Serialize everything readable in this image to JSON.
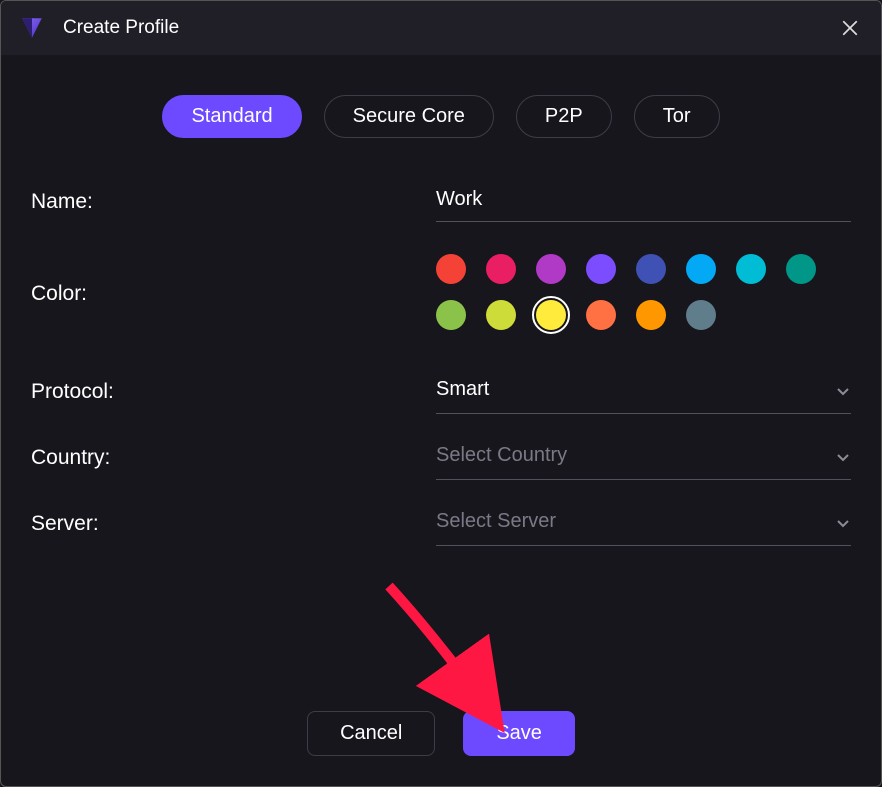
{
  "header": {
    "title": "Create Profile"
  },
  "tabs": {
    "standard": "Standard",
    "secure_core": "Secure Core",
    "p2p": "P2P",
    "tor": "Tor",
    "active": "standard"
  },
  "labels": {
    "name": "Name:",
    "color": "Color:",
    "protocol": "Protocol:",
    "country": "Country:",
    "server": "Server:"
  },
  "fields": {
    "name_value": "Work",
    "protocol_value": "Smart",
    "country_placeholder": "Select Country",
    "server_placeholder": "Select Server"
  },
  "colors": {
    "options": [
      "#f44336",
      "#e91e63",
      "#b039c6",
      "#7c4dff",
      "#3f51b5",
      "#03a9f4",
      "#00bcd4",
      "#009688",
      "#8bc34a",
      "#cddc39",
      "#ffeb3b",
      "#ff7043",
      "#ff9800",
      "#607d8b"
    ],
    "selected_index": 10
  },
  "buttons": {
    "cancel": "Cancel",
    "save": "Save"
  },
  "annotation": {
    "arrow_target": "save-button"
  }
}
